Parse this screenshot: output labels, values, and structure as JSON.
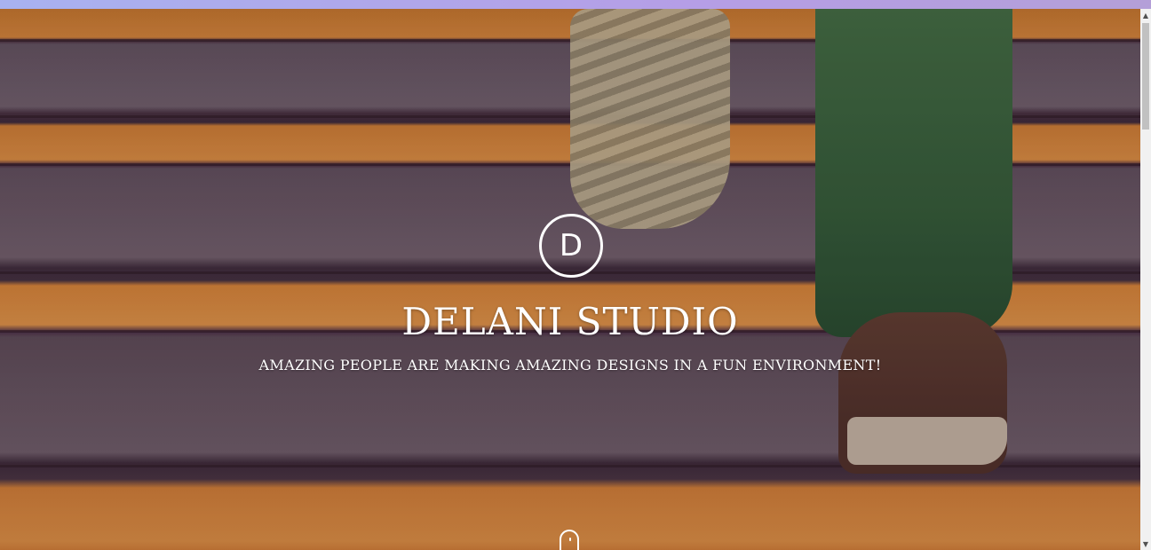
{
  "hero": {
    "logo_letter": "D",
    "title": "DELANI STUDIO",
    "subtitle": "AMAZING PEOPLE ARE MAKING AMAZING DESIGNS IN A FUN ENVIRONMENT!"
  },
  "icons": {
    "scroll_up": "▲",
    "scroll_down": "▼",
    "scroll_indicator": "mouse-scroll-icon"
  },
  "colors": {
    "accent_stripe": "#a8b2f0",
    "stair_orange": "#f2a534",
    "text": "#ffffff"
  }
}
